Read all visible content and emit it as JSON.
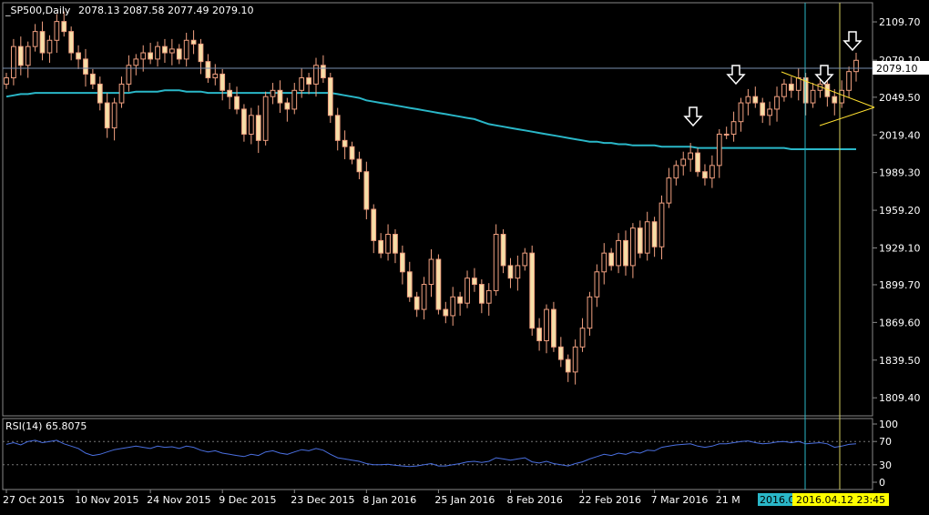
{
  "header": {
    "symbol": "_SP500,Daily",
    "ohlc": "2078.13 2087.58 2077.49 2079.10"
  },
  "current_price_label": "2079.10",
  "rsi_label": "RSI(14) 65.8075",
  "crosshair": {
    "date_label_a": "2016.0",
    "date_label_b": "2016.04.12 23:45"
  },
  "colors": {
    "background": "#000000",
    "candle_up": "#000000",
    "candle_down": "#f5dfa8",
    "wick": "#f0a080",
    "ma_line": "#2ab7c8",
    "rsi_line": "#4a6fe0",
    "triangle": "#ffe030",
    "axis": "#888888",
    "text": "#ffffff"
  },
  "chart_data": [
    {
      "type": "candlestick",
      "title": "_SP500,Daily",
      "ylim": [
        1795,
        2125
      ],
      "y_ticks": [
        "2109.70",
        "2079.10",
        "2049.50",
        "2019.40",
        "1989.30",
        "1959.20",
        "1929.10",
        "1899.70",
        "1869.60",
        "1839.50",
        "1809.40"
      ],
      "x_tick_labels": [
        "27 Oct 2015",
        "10 Nov 2015",
        "24 Nov 2015",
        "9 Dec 2015",
        "23 Dec 2015",
        "8 Jan 2016",
        "25 Jan 2016",
        "8 Feb 2016",
        "22 Feb 2016",
        "7 Mar 2016",
        "21 M"
      ],
      "closes": [
        2065,
        2090,
        2075,
        2090,
        2102,
        2085,
        2095,
        2110,
        2102,
        2085,
        2080,
        2068,
        2060,
        2045,
        2025,
        2045,
        2060,
        2075,
        2080,
        2085,
        2080,
        2090,
        2085,
        2088,
        2080,
        2095,
        2092,
        2078,
        2065,
        2068,
        2055,
        2050,
        2040,
        2020,
        2035,
        2015,
        2050,
        2055,
        2045,
        2040,
        2055,
        2065,
        2060,
        2075,
        2065,
        2035,
        2015,
        2010,
        2000,
        1990,
        1960,
        1935,
        1925,
        1940,
        1925,
        1910,
        1890,
        1880,
        1900,
        1920,
        1880,
        1875,
        1890,
        1885,
        1905,
        1900,
        1885,
        1895,
        1940,
        1915,
        1905,
        1915,
        1925,
        1865,
        1855,
        1880,
        1850,
        1840,
        1830,
        1850,
        1865,
        1890,
        1910,
        1925,
        1915,
        1935,
        1915,
        1945,
        1925,
        1950,
        1930,
        1965,
        1985,
        1995,
        2000,
        2005,
        1990,
        1985,
        1995,
        2020,
        2020,
        2030,
        2045,
        2050,
        2045,
        2035,
        2040,
        2050,
        2060,
        2055,
        2065,
        2045,
        2055,
        2060,
        2050,
        2045,
        2055,
        2070,
        2079
      ],
      "series": [
        {
          "name": "MA",
          "kind": "line",
          "values": [
            2050,
            2051,
            2052,
            2052,
            2053,
            2053,
            2053,
            2053,
            2053,
            2053,
            2053,
            2053,
            2053,
            2053,
            2053,
            2053,
            2053,
            2053,
            2054,
            2054,
            2054,
            2054,
            2055,
            2055,
            2055,
            2054,
            2054,
            2054,
            2053,
            2053,
            2053,
            2053,
            2053,
            2053,
            2053,
            2053,
            2053,
            2053,
            2053,
            2053,
            2053,
            2053,
            2053,
            2053,
            2053,
            2053,
            2052,
            2051,
            2050,
            2049,
            2047,
            2046,
            2045,
            2044,
            2043,
            2042,
            2041,
            2040,
            2039,
            2038,
            2037,
            2036,
            2035,
            2034,
            2033,
            2032,
            2030,
            2028,
            2027,
            2026,
            2025,
            2024,
            2023,
            2022,
            2021,
            2020,
            2019,
            2018,
            2017,
            2016,
            2015,
            2014,
            2014,
            2013,
            2013,
            2012,
            2012,
            2011,
            2011,
            2011,
            2011,
            2010,
            2010,
            2010,
            2010,
            2010,
            2009,
            2009,
            2009,
            2009,
            2009,
            2009,
            2009,
            2009,
            2009,
            2009,
            2009,
            2009,
            2009,
            2008,
            2008,
            2008,
            2008,
            2008,
            2008,
            2008,
            2008,
            2008,
            2008
          ]
        },
        {
          "name": "RSI(14)",
          "kind": "oscillator",
          "ylim": [
            0,
            100
          ],
          "levels": [
            30,
            70
          ],
          "y_ticks": [
            "100",
            "70",
            "30",
            "0"
          ],
          "values": [
            65,
            68,
            64,
            70,
            72,
            68,
            70,
            72,
            66,
            62,
            58,
            50,
            46,
            48,
            52,
            56,
            58,
            60,
            62,
            60,
            58,
            62,
            60,
            61,
            58,
            62,
            60,
            55,
            52,
            54,
            50,
            48,
            46,
            44,
            48,
            46,
            52,
            54,
            50,
            48,
            52,
            56,
            54,
            58,
            55,
            48,
            42,
            40,
            38,
            36,
            32,
            30,
            30,
            31,
            29,
            28,
            27,
            28,
            30,
            32,
            28,
            28,
            30,
            32,
            35,
            36,
            34,
            36,
            42,
            40,
            38,
            40,
            42,
            35,
            33,
            36,
            32,
            30,
            28,
            32,
            35,
            40,
            44,
            48,
            46,
            50,
            48,
            52,
            50,
            55,
            54,
            60,
            62,
            64,
            65,
            66,
            62,
            60,
            62,
            66,
            66,
            68,
            70,
            71,
            68,
            66,
            67,
            69,
            70,
            68,
            70,
            66,
            67,
            68,
            66,
            60,
            62,
            65,
            66
          ]
        }
      ],
      "annotations": [
        "down-arrow",
        "down-arrow",
        "down-arrow",
        "down-arrow",
        "symmetric-triangle"
      ]
    }
  ]
}
